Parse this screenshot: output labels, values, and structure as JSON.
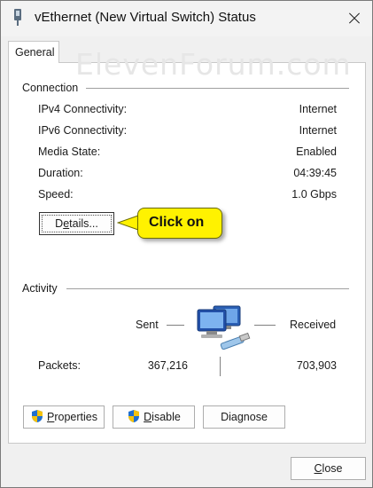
{
  "window": {
    "title": "vEthernet (New Virtual Switch) Status"
  },
  "tabs": [
    {
      "label": "General"
    }
  ],
  "watermark": "ElevenForum.com",
  "connection": {
    "heading": "Connection",
    "rows": [
      {
        "label": "IPv4 Connectivity:",
        "value": "Internet"
      },
      {
        "label": "IPv6 Connectivity:",
        "value": "Internet"
      },
      {
        "label": "Media State:",
        "value": "Enabled"
      },
      {
        "label": "Duration:",
        "value": "04:39:45"
      },
      {
        "label": "Speed:",
        "value": "1.0 Gbps"
      }
    ],
    "details_button": {
      "prefix": "D",
      "underlined": "e",
      "suffix": "tails..."
    }
  },
  "callout": {
    "text": "Click on",
    "color": "#fff200"
  },
  "activity": {
    "heading": "Activity",
    "sent_label": "Sent",
    "received_label": "Received",
    "packets_label": "Packets:",
    "sent_packets": "367,216",
    "received_packets": "703,903"
  },
  "buttons": {
    "properties": {
      "underlined": "P",
      "rest": "roperties",
      "icon": "shield-icon"
    },
    "disable": {
      "underlined": "D",
      "rest": "isable",
      "icon": "shield-icon"
    },
    "diagnose": {
      "prefix": "Dia",
      "underlined": "g",
      "rest": "nose"
    },
    "close": {
      "underlined": "C",
      "rest": "lose"
    }
  }
}
